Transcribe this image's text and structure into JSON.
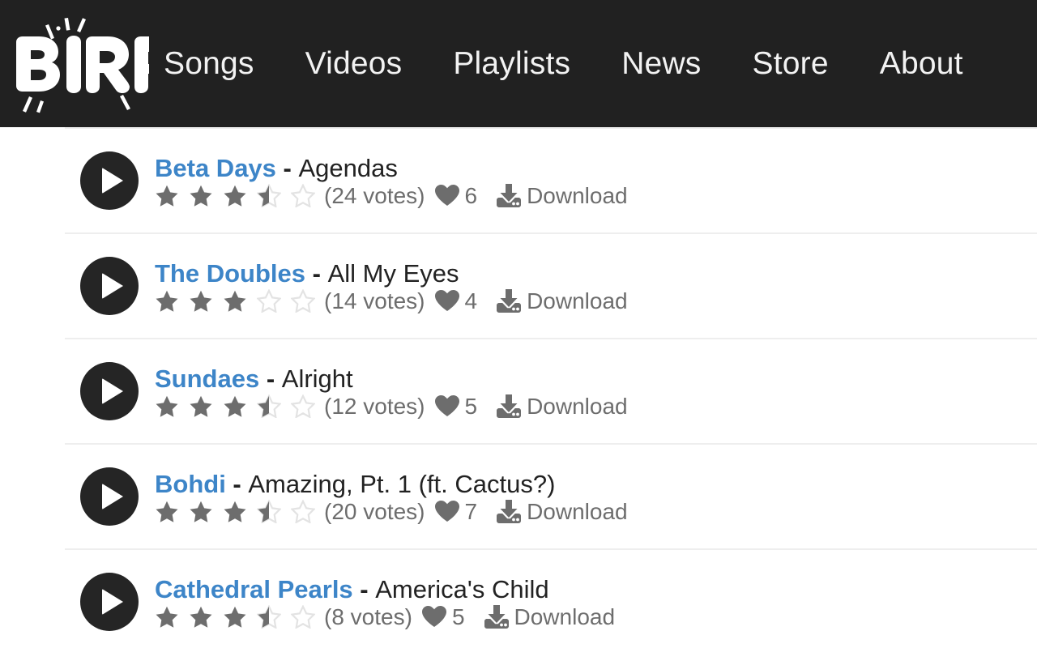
{
  "header": {
    "logo_text": "BIRP!",
    "logo_name": "birp-logo",
    "background_color": "#212121",
    "nav": [
      {
        "label": "Songs",
        "name": "nav-item-songs"
      },
      {
        "label": "Videos",
        "name": "nav-item-videos"
      },
      {
        "label": "Playlists",
        "name": "nav-item-playlists"
      },
      {
        "label": "News",
        "name": "nav-item-news"
      },
      {
        "label": "Store",
        "name": "nav-item-store"
      },
      {
        "label": "About",
        "name": "nav-item-about"
      }
    ]
  },
  "colors": {
    "artist_link": "#3d85c8",
    "track_text": "#222222",
    "meta_text": "#6d6d6d",
    "star_full": "#6d6d6d",
    "star_empty": "#e3e3e3",
    "divider": "#eeeeee",
    "play_button": "#252525"
  },
  "icons": {
    "play": "play-icon",
    "heart": "heart-icon",
    "download": "download-icon",
    "star_full": "star-full-icon",
    "star_half": "star-half-icon",
    "star_empty": "star-empty-icon"
  },
  "labels": {
    "download": "Download"
  },
  "songs": [
    {
      "artist": "Beta Days",
      "separator": " - ",
      "track": "Agendas",
      "rating": 3.5,
      "votes_text": "(24 votes)",
      "votes": 24,
      "loves": 6,
      "download_label": "Download"
    },
    {
      "artist": "The Doubles",
      "separator": " - ",
      "track": "All My Eyes",
      "rating": 3,
      "votes_text": "(14 votes)",
      "votes": 14,
      "loves": 4,
      "download_label": "Download"
    },
    {
      "artist": "Sundaes",
      "separator": " - ",
      "track": "Alright",
      "rating": 3.5,
      "votes_text": "(12 votes)",
      "votes": 12,
      "loves": 5,
      "download_label": "Download"
    },
    {
      "artist": "Bohdi",
      "separator": " - ",
      "track": "Amazing, Pt. 1 (ft. Cactus?)",
      "rating": 3.5,
      "votes_text": "(20 votes)",
      "votes": 20,
      "loves": 7,
      "download_label": "Download"
    },
    {
      "artist": "Cathedral Pearls",
      "separator": " - ",
      "track": "America's Child",
      "rating": 3.5,
      "votes_text": "(8 votes)",
      "votes": 8,
      "loves": 5,
      "download_label": "Download"
    }
  ]
}
